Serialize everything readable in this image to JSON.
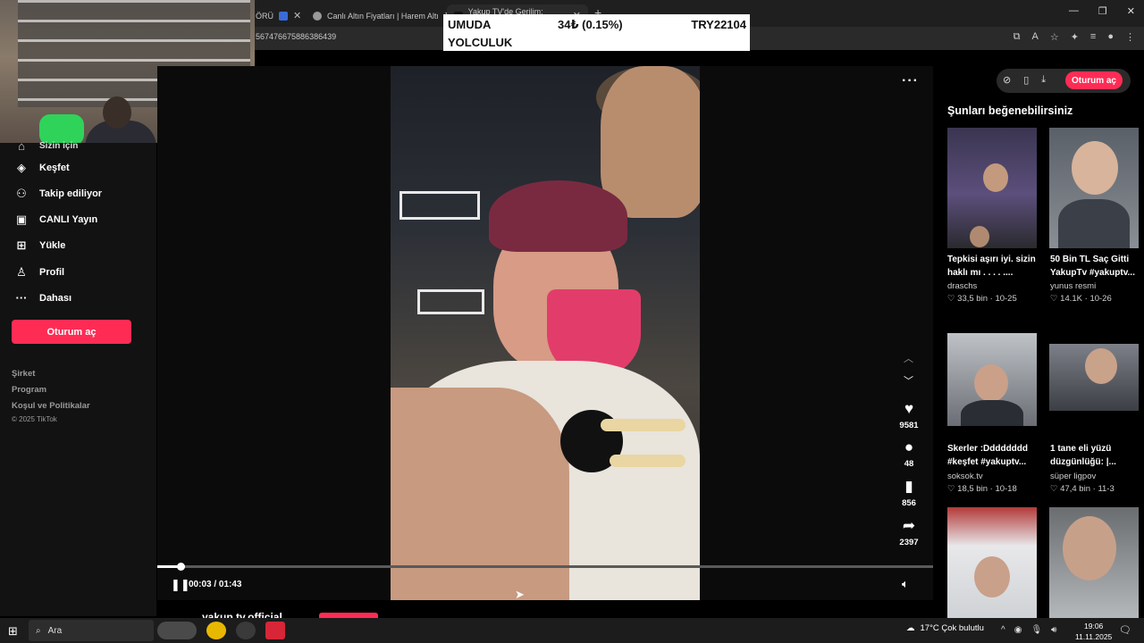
{
  "browser": {
    "tabs": [
      {
        "label": "ÖRÜ",
        "active": false
      },
      {
        "label": "Canlı Altın Fiyatları | Harem Altı",
        "active": false
      },
      {
        "label": "Yakup TV'de Gerilim: İşkencı",
        "active": true
      }
    ],
    "url": "567476675886386439",
    "window_buttons": [
      "—",
      "❐",
      "✕"
    ]
  },
  "ticker": {
    "name_line1": "UMUDA",
    "name_line2": "YOLCULUK",
    "change": "34₺ (0.15%)",
    "total": "TRY22104"
  },
  "sidebar": {
    "partial_item": "Sizin için",
    "items": [
      {
        "label": "Keşfet",
        "icon": "compass-icon"
      },
      {
        "label": "Takip ediliyor",
        "icon": "following-icon"
      },
      {
        "label": "CANLI Yayın",
        "icon": "live-icon"
      },
      {
        "label": "Yükle",
        "icon": "upload-icon"
      },
      {
        "label": "Profil",
        "icon": "profile-icon"
      },
      {
        "label": "Dahası",
        "icon": "more-icon"
      }
    ],
    "login_label": "Oturum aç",
    "footer_links": [
      "Şirket",
      "Program",
      "Koşul ve Politikalar"
    ],
    "copyright": "© 2025 TikTok"
  },
  "player": {
    "time": "00:03 / 01:43",
    "progress": 0.03,
    "author": "yakup.tv.official",
    "actions": [
      {
        "name": "like",
        "icon": "heart-icon",
        "count": "9581"
      },
      {
        "name": "comment",
        "icon": "comment-icon",
        "count": "48"
      },
      {
        "name": "save",
        "icon": "bookmark-icon",
        "count": "856"
      },
      {
        "name": "share",
        "icon": "share-icon",
        "count": "2397"
      }
    ]
  },
  "right_panel": {
    "login_label": "Oturum aç",
    "title": "Şunları beğenebilirsiniz",
    "cards": [
      {
        "title": "Tepkisi aşırı iyi. sizin haklı mı . . . . ....",
        "user": "draschs",
        "likes": "33,5 bin",
        "date": "10-25"
      },
      {
        "title": "50 Bin TL Saç Gitti YakupTv #yakuptv...",
        "user": "yunus resmi",
        "likes": "14.1K",
        "date": "10-26"
      },
      {
        "title": "Skerler :Dddddddd #keşfet #yakuptv...",
        "user": "soksok.tv",
        "likes": "18,5 bin",
        "date": "10-18"
      },
      {
        "title": "1 tane eli yüzü düzgünlüğü: |...",
        "user": "süper ligpov",
        "likes": "47,4 bin",
        "date": "11-3"
      }
    ]
  },
  "taskbar": {
    "search_placeholder": "Ara",
    "weather": "17°C Çok bulutlu",
    "time": "19:06",
    "date": "11.11.2025"
  }
}
